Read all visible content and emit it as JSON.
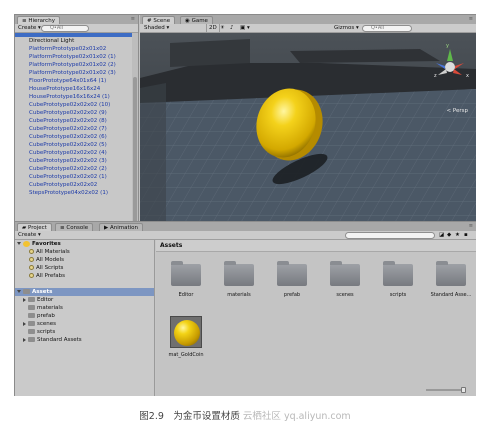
{
  "hierarchy": {
    "tab": "Hierarchy",
    "create": "Create",
    "search_prefix": "Q•All",
    "items": [
      "Directional Light",
      "PlatformPrototype02x01x02",
      "PlatformPrototype02x01x02 (1)",
      "PlatformPrototype02x01x02 (2)",
      "PlatformPrototype02x01x02 (3)",
      "FloorPrototype64x01x64 (1)",
      "HousePrototype16x16x24",
      "HousePrototype16x16x24 (1)",
      "CubePrototype02x02x02 (10)",
      "CubePrototype02x02x02 (9)",
      "CubePrototype02x02x02 (8)",
      "CubePrototype02x02x02 (7)",
      "CubePrototype02x02x02 (6)",
      "CubePrototype02x02x02 (5)",
      "CubePrototype02x02x02 (4)",
      "CubePrototype02x02x02 (3)",
      "CubePrototype02x02x02 (2)",
      "CubePrototype02x02x02 (1)",
      "CubePrototype02x02x02",
      "StepsPrototype04x02x02 (1)"
    ]
  },
  "scene": {
    "tabs": [
      "Scene",
      "Game"
    ],
    "shaded": "Shaded",
    "mode_2d": "2D",
    "gizmos": "Gizmos",
    "search": "Q•All",
    "persp": "< Persp",
    "axis_y": "y",
    "axis_x": "x",
    "axis_z": "z"
  },
  "project": {
    "tabs": [
      "Project",
      "Console",
      "Animation"
    ],
    "create": "Create",
    "favorites": {
      "label": "Favorites",
      "items": [
        "All Materials",
        "All Models",
        "All Scripts",
        "All Prefabs"
      ]
    },
    "assets_root": "Assets",
    "asset_folders": [
      "Editor",
      "materials",
      "prefab",
      "scenes",
      "scripts",
      "Standard Assets"
    ],
    "breadcrumb": "Assets",
    "grid_items": [
      "Editor",
      "materials",
      "prefab",
      "scenes",
      "scripts",
      "Standard Asse..."
    ],
    "material": "mat_GoldCoin"
  },
  "caption": {
    "text": "图2.9　为金币设置材质",
    "watermark": "云栖社区 yq.aliyun.com"
  }
}
